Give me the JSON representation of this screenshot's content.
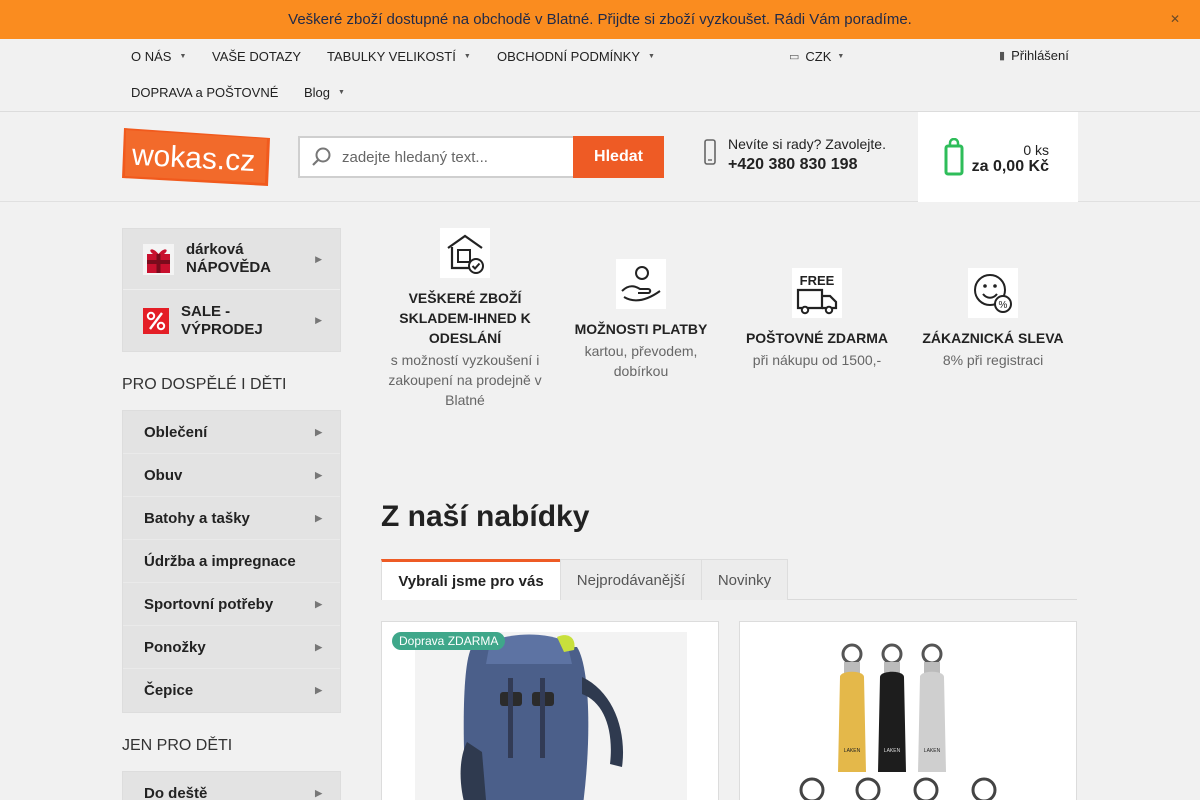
{
  "banner": {
    "text": "Veškeré zboží dostupné na obchodě v Blatné. Přijdte si zboží vyzkoušet. Rádi Vám poradíme.",
    "close_icon": "close-icon"
  },
  "menu": {
    "items": [
      "O NÁS",
      "VAŠE DOTAZY",
      "TABULKY VELIKOSTÍ",
      "OBCHODNÍ PODMÍNKY",
      "DOPRAVA a POŠTOVNÉ",
      "Blog"
    ],
    "currency": "CZK",
    "login": "Přihlášení"
  },
  "header": {
    "logo_text": "wokas.cz",
    "search_placeholder": "zadejte hledaný text...",
    "search_button": "Hledat",
    "contact_question": "Nevíte si rady? Zavolejte.",
    "phone": "+420 380 830 198",
    "cart_qty": "0 ks",
    "cart_total": "za 0,00 Kč"
  },
  "sidebar": {
    "promo": [
      {
        "label": "dárková NÁPOVĚDA",
        "icon": "gift-icon"
      },
      {
        "label": "SALE - VÝPRODEJ",
        "icon": "percent-icon"
      }
    ],
    "section1_title": "PRO DOSPĚLÉ I DĚTI",
    "categories": [
      "Oblečení",
      "Obuv",
      "Batohy a tašky",
      "Údržba a impregnace",
      "Sportovní potřeby",
      "Ponožky",
      "Čepice"
    ],
    "section2_title": "JEN PRO DĚTI",
    "kids_categories": [
      "Do deště"
    ]
  },
  "benefits": [
    {
      "title": "VEŠKERÉ ZBOŽÍ SKLADEM-IHNED K ODESLÁNÍ",
      "subtitle": "s možností vyzkoušení i zakoupení na prodejně v Blatné",
      "icon": "warehouse-icon"
    },
    {
      "title": "MOŽNOSTI PLATBY",
      "subtitle": "kartou, převodem, dobírkou",
      "icon": "payment-hand-icon"
    },
    {
      "title": "POŠTOVNÉ ZDARMA",
      "subtitle": "při nákupu od 1500,-",
      "icon": "free-delivery-icon",
      "icon_text": "FREE"
    },
    {
      "title": "ZÁKAZNICKÁ SLEVA",
      "subtitle": "8% při registraci",
      "icon": "discount-smile-icon"
    }
  ],
  "offer": {
    "title": "Z naší nabídky",
    "tabs": [
      "Vybrali jsme pro vás",
      "Nejprodávanější",
      "Novinky"
    ]
  },
  "products": [
    {
      "badge": "Doprava ZDARMA",
      "image": "backpack-image"
    },
    {
      "image": "bottles-image",
      "brand_label": "LAKEN"
    }
  ],
  "colors": {
    "accent": "#ee5b25",
    "banner": "#fa8c1f",
    "cart_icon": "#2ebd5a"
  }
}
